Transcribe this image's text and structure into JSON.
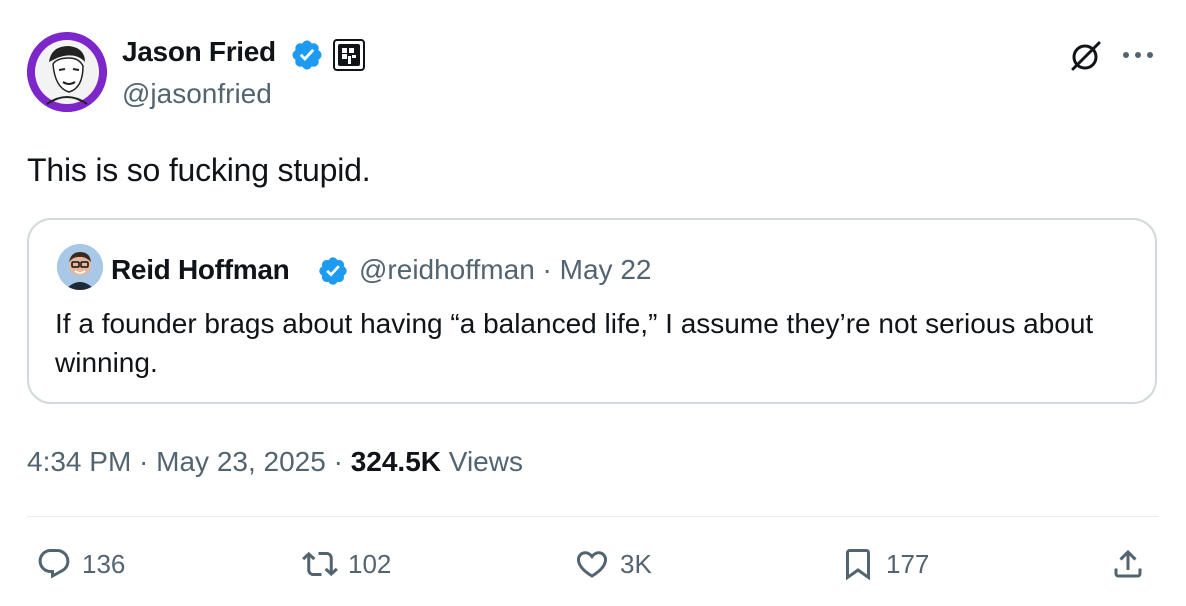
{
  "author": {
    "name": "Jason Fried",
    "handle": "@jasonfried"
  },
  "icons": {
    "verified": "verified-badge-icon",
    "affiliate": "affiliate-badge-icon",
    "grok": "grok-icon",
    "more": "more-icon",
    "reply": "reply-icon",
    "repost": "repost-icon",
    "like": "like-icon",
    "bookmark": "bookmark-icon",
    "share": "share-icon"
  },
  "tweet_text": "This is so fucking stupid.",
  "quoted": {
    "name": "Reid Hoffman",
    "meta": "@reidhoffman · May 22",
    "text": "If a founder brags about having “a balanced life,” I assume they’re not serious about winning."
  },
  "timestamp": "4:34 PM · May 23, 2025 · ",
  "views_count": "324.5K",
  "views_label": " Views",
  "actions": {
    "replies": "136",
    "reposts": "102",
    "likes": "3K",
    "bookmarks": "177"
  },
  "colors": {
    "verified_blue": "#1d9bf0",
    "secondary_text": "#536471",
    "avatar_purple": "#7d26c9"
  }
}
